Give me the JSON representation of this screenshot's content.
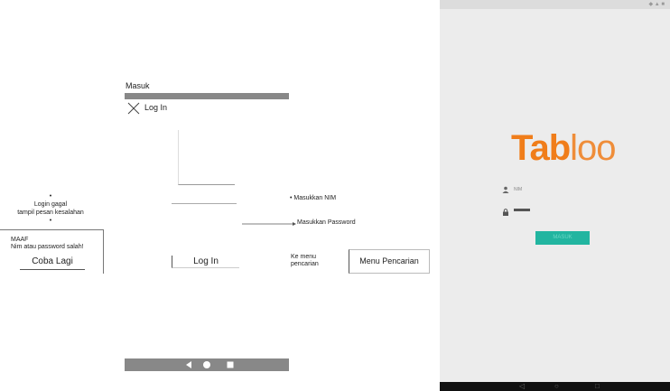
{
  "wireframe": {
    "title": "Masuk",
    "header_login": "Log In",
    "login_button": "Log In",
    "annotations": {
      "nim": "Masukkan NIM",
      "password": "Masukkan Password",
      "search_line1": "Ke menu",
      "search_line2": "pencarian"
    },
    "search_button": "Menu Pencarian",
    "failed_line1": "Login gagal",
    "failed_line2": "tampil pesan kesalahan",
    "error_title": "MAAF",
    "error_message": "Nim atau password salah!",
    "retry_button": "Coba Lagi"
  },
  "app": {
    "logo_bold": "Tab",
    "logo_light": "loo",
    "nim_hint": "NIM",
    "login_button": "MASUK",
    "colors": {
      "brand": "#f07d1a",
      "button": "#22b5a0",
      "screen": "#ececec"
    }
  }
}
